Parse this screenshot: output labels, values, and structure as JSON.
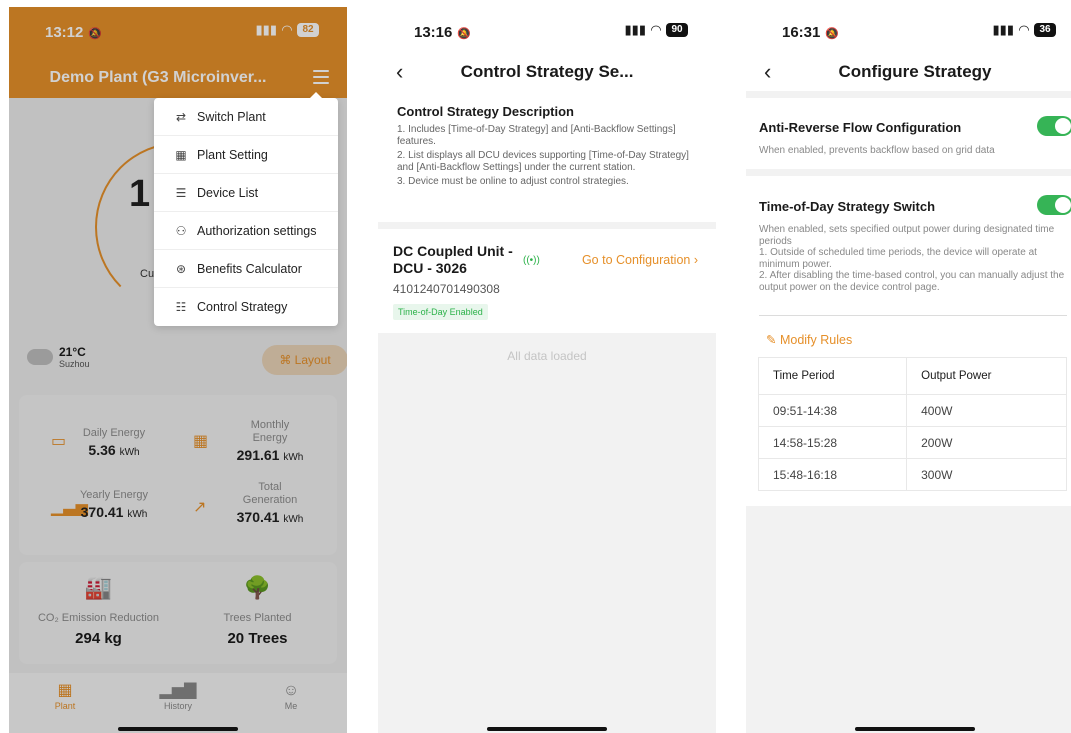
{
  "phone1": {
    "status": {
      "time": "13:12",
      "battery": "82"
    },
    "plant_title": "Demo Plant (G3 Microinver...",
    "big_number_partial": "1",
    "center_label_partial": "Cu",
    "weather": {
      "temp": "21°C",
      "city": "Suzhou"
    },
    "layout_label": "Layout",
    "menu": [
      {
        "label": "Switch Plant",
        "icon": "switch-icon"
      },
      {
        "label": "Plant Setting",
        "icon": "grid-icon"
      },
      {
        "label": "Device List",
        "icon": "list-icon"
      },
      {
        "label": "Authorization settings",
        "icon": "person-icon"
      },
      {
        "label": "Benefits Calculator",
        "icon": "calculator-icon"
      },
      {
        "label": "Control Strategy",
        "icon": "server-icon"
      }
    ],
    "energy": {
      "daily_label": "Daily Energy",
      "daily_value": "5.36",
      "daily_unit": "kWh",
      "monthly_label": "Monthly Energy",
      "monthly_value": "291.61",
      "monthly_unit": "kWh",
      "yearly_label": "Yearly Energy",
      "yearly_value": "370.41",
      "yearly_unit": "kWh",
      "total_label": "Total Generation",
      "total_value": "370.41",
      "total_unit": "kWh"
    },
    "impact": {
      "co2_label": "CO₂ Emission Reduction",
      "co2_value": "294 kg",
      "trees_label": "Trees Planted",
      "trees_value": "20 Trees"
    },
    "tabs": [
      "Plant",
      "History",
      "Me"
    ]
  },
  "phone2": {
    "status": {
      "time": "13:16",
      "battery": "90"
    },
    "title": "Control Strategy Se...",
    "desc_title": "Control Strategy Description",
    "desc_lines": [
      "1. Includes [Time-of-Day Strategy] and [Anti-Backflow Settings] features.",
      "2. List displays all DCU devices supporting [Time-of-Day Strategy] and [Anti-Backflow Settings] under the current station.",
      "3. Device must be online to adjust control strategies."
    ],
    "device": {
      "name": "DC Coupled Unit - DCU - 3026",
      "serial": "4101240701490308",
      "badge": "Time-of-Day Enabled",
      "go_label": "Go to Configuration"
    },
    "all_loaded": "All data loaded"
  },
  "phone3": {
    "status": {
      "time": "16:31",
      "battery": "36"
    },
    "title": "Configure Strategy",
    "anti_title": "Anti-Reverse Flow Configuration",
    "anti_desc": "When enabled, prevents backflow based on grid data",
    "anti_enabled": true,
    "tod_title": "Time-of-Day Strategy Switch",
    "tod_desc_lines": [
      "When enabled, sets specified output power during designated time periods",
      "1. Outside of scheduled time periods, the device will operate at minimum power.",
      "2. After disabling the time-based control, you can manually adjust the output power on the device control page."
    ],
    "tod_enabled": true,
    "modify_label": "Modify Rules",
    "table_headers": [
      "Time Period",
      "Output Power"
    ],
    "rules": [
      {
        "period": "09:51-14:38",
        "power": "400W"
      },
      {
        "period": "14:58-15:28",
        "power": "200W"
      },
      {
        "period": "15:48-16:18",
        "power": "300W"
      }
    ]
  },
  "colors": {
    "accent": "#e6902a",
    "green": "#36b456"
  }
}
